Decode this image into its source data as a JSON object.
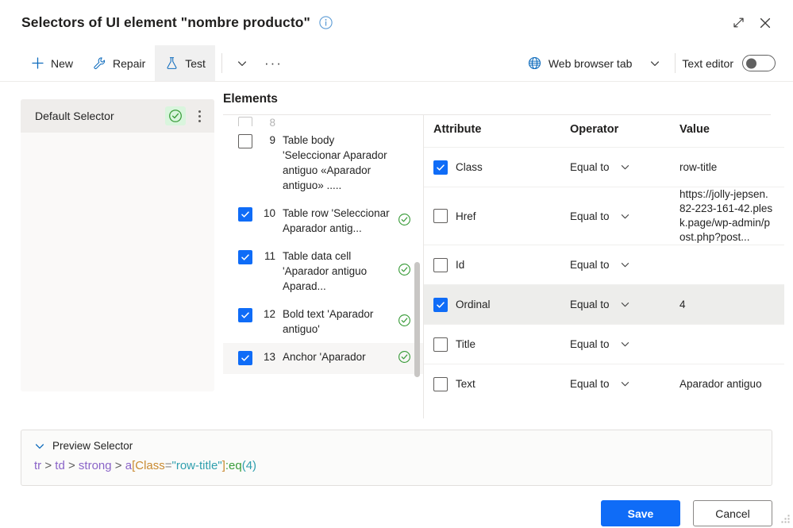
{
  "window": {
    "title": "Selectors of UI element \"nombre producto\"",
    "info_icon": "info-circle-icon",
    "maximize_icon": "maximize-icon",
    "close_icon": "close-icon"
  },
  "commandbar": {
    "new_label": "New",
    "new_icon": "plus-icon",
    "repair_label": "Repair",
    "repair_icon": "wrench-icon",
    "test_label": "Test",
    "test_icon": "flask-icon",
    "overflow_caret_icon": "chevron-down-icon",
    "more_icon": "ellipsis-icon",
    "scope_label": "Web browser tab",
    "scope_icon": "globe-icon",
    "scope_caret_icon": "chevron-down-icon",
    "text_editor_label": "Text editor",
    "text_editor_state": "off"
  },
  "left_panel": {
    "selector_name": "Default Selector",
    "status_icon": "check-circle-icon",
    "menu_icon": "kebab-menu-icon"
  },
  "elements": {
    "header": "Elements",
    "rows": [
      {
        "index": "8",
        "label": "",
        "checked": false,
        "valid": false,
        "partial": true,
        "highlight": false
      },
      {
        "index": "9",
        "label": "Table body 'Seleccionar Aparador antiguo «Aparador antiguo»  .....",
        "checked": false,
        "valid": false,
        "partial": false,
        "highlight": false
      },
      {
        "index": "10",
        "label": "Table row 'Seleccionar Aparador antig...",
        "checked": true,
        "valid": true,
        "partial": false,
        "highlight": false
      },
      {
        "index": "11",
        "label": "Table data cell 'Aparador antiguo Aparad...",
        "checked": true,
        "valid": true,
        "partial": false,
        "highlight": false
      },
      {
        "index": "12",
        "label": "Bold text 'Aparador antiguo'",
        "checked": true,
        "valid": true,
        "partial": false,
        "highlight": false
      },
      {
        "index": "13",
        "label": "Anchor 'Aparador",
        "checked": true,
        "valid": true,
        "partial": false,
        "highlight": true
      }
    ]
  },
  "attributes": {
    "columns": {
      "attribute": "Attribute",
      "operator": "Operator",
      "value": "Value"
    },
    "rows": [
      {
        "name": "Class",
        "operator": "Equal to",
        "value": "row-title",
        "checked": true,
        "selected": false
      },
      {
        "name": "Href",
        "operator": "Equal to",
        "value": "https://jolly-jepsen.82-223-161-42.plesk.page/wp-admin/post.php?post...",
        "checked": false,
        "selected": false
      },
      {
        "name": "Id",
        "operator": "Equal to",
        "value": "",
        "checked": false,
        "selected": false
      },
      {
        "name": "Ordinal",
        "operator": "Equal to",
        "value": "4",
        "checked": true,
        "selected": true
      },
      {
        "name": "Title",
        "operator": "Equal to",
        "value": "",
        "checked": false,
        "selected": false
      },
      {
        "name": "Text",
        "operator": "Equal to",
        "value": "Aparador antiguo",
        "checked": false,
        "selected": false
      }
    ]
  },
  "preview": {
    "label": "Preview Selector",
    "chevron_icon": "chevron-down-icon",
    "tokens": [
      {
        "text": "tr",
        "kind": "tag"
      },
      {
        "text": " > ",
        "kind": "comb"
      },
      {
        "text": "td",
        "kind": "tag"
      },
      {
        "text": " > ",
        "kind": "comb"
      },
      {
        "text": "strong",
        "kind": "tag"
      },
      {
        "text": " > ",
        "kind": "comb"
      },
      {
        "text": "a",
        "kind": "tag"
      },
      {
        "text": "[",
        "kind": "brk"
      },
      {
        "text": "Class",
        "kind": "attr"
      },
      {
        "text": "=",
        "kind": "eq"
      },
      {
        "text": "\"row-title\"",
        "kind": "str"
      },
      {
        "text": "]",
        "kind": "brk"
      },
      {
        "text": ":eq",
        "kind": "pseudo"
      },
      {
        "text": "(4)",
        "kind": "paren"
      }
    ],
    "full_text": "tr > td > strong > a[Class=\"row-title\"]:eq(4)"
  },
  "footer": {
    "save_label": "Save",
    "cancel_label": "Cancel"
  },
  "colors": {
    "accent": "#0f6cf7",
    "link": "#0f6cbd",
    "ok_green": "#3a9c3a",
    "ok_green_bg": "#d9f5dd",
    "panel_bg": "#faf9f8",
    "selected_row": "#ededeb"
  }
}
